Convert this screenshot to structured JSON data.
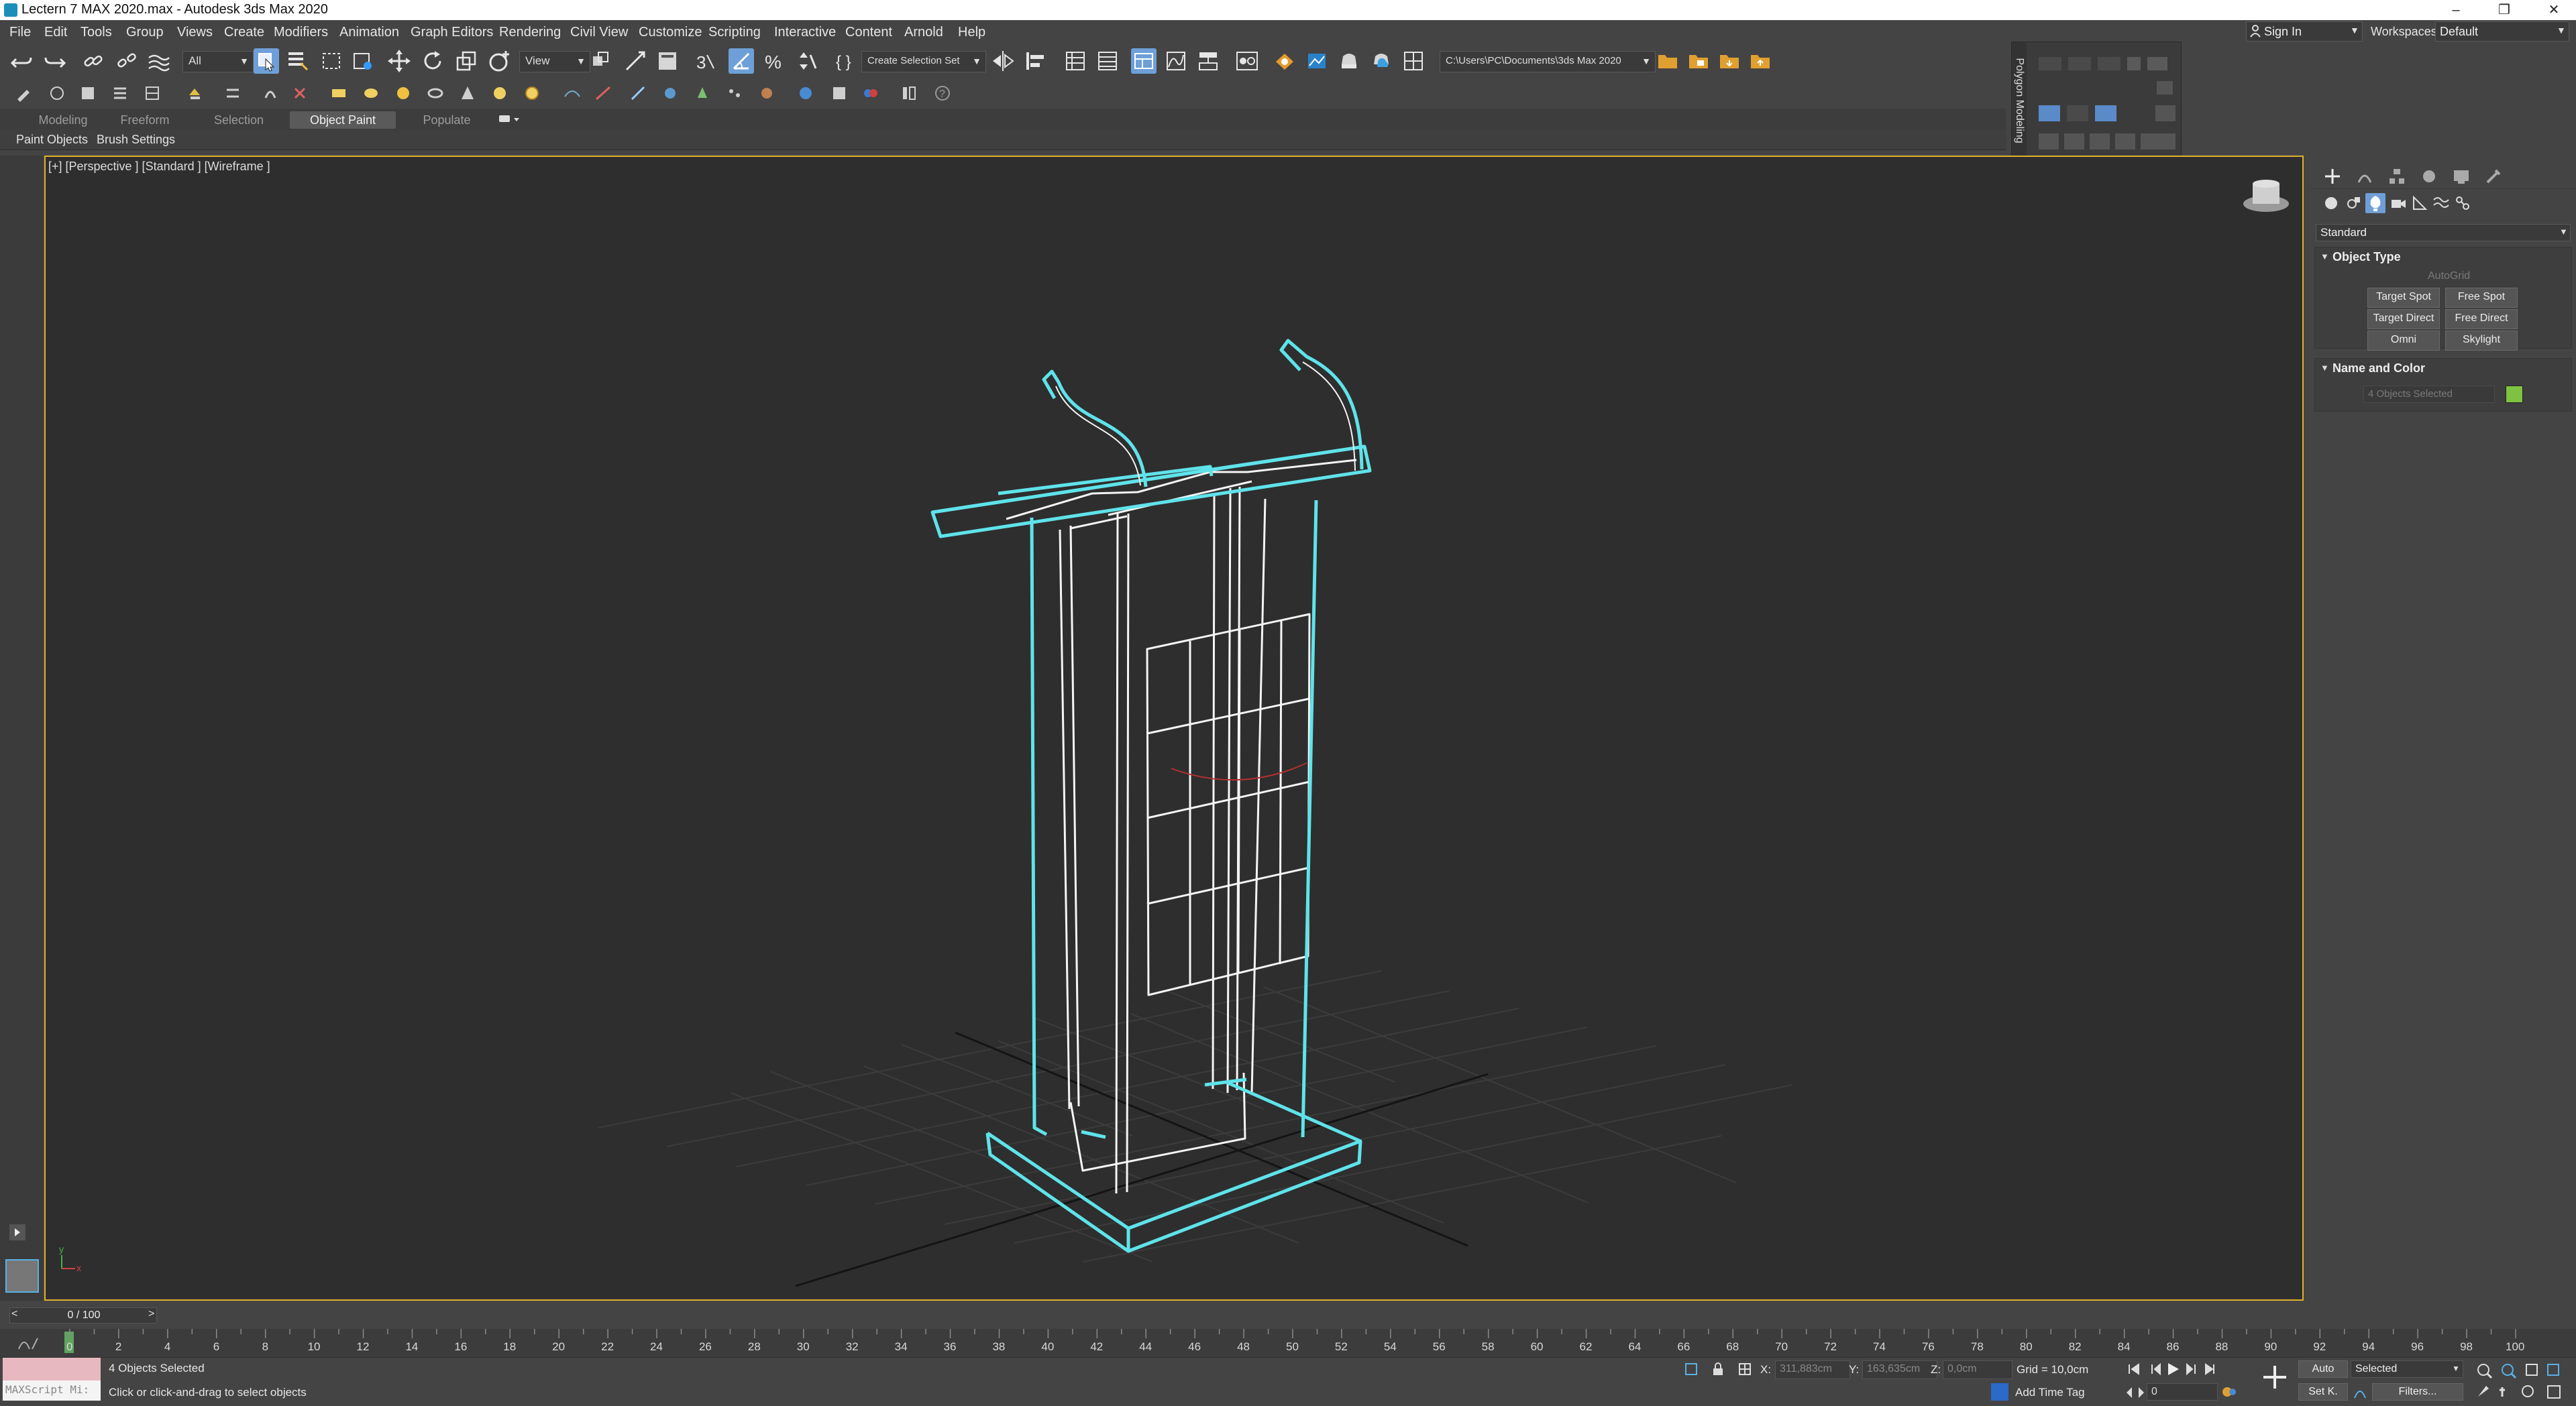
{
  "window": {
    "title": "Lectern 7 MAX 2020.max - Autodesk 3ds Max 2020",
    "minimize": "–",
    "restore": "❐",
    "close": "✕"
  },
  "menu": [
    "File",
    "Edit",
    "Tools",
    "Group",
    "Views",
    "Create",
    "Modifiers",
    "Animation",
    "Graph Editors",
    "Rendering",
    "Civil View",
    "Customize",
    "Scripting",
    "Interactive",
    "Content",
    "Arnold",
    "Help"
  ],
  "account": {
    "sign_in": "Sign In",
    "workspaces_label": "Workspaces:",
    "workspace_value": "Default"
  },
  "toolbar": {
    "selection_filter": "All",
    "ref_coord": "View",
    "named_selection": "Create Selection Set",
    "project_path": "C:\\Users\\PC\\Documents\\3ds Max 2020"
  },
  "ribbon": {
    "tabs": [
      "Modeling",
      "Freeform",
      "Selection",
      "Object Paint",
      "Populate"
    ],
    "active_tab": "Object Paint",
    "sub_items": [
      "Paint Objects",
      "Brush Settings"
    ]
  },
  "poly_float": {
    "label": "Polygon Modeling"
  },
  "viewport": {
    "label": "[+] [Perspective ] [Standard ] [Wireframe ]",
    "wire_color": "#5fe3ea",
    "axis_x": "x",
    "axis_y": "y"
  },
  "command_panel": {
    "category": "Standard",
    "object_type": {
      "header": "Object Type",
      "autogrid": "AutoGrid",
      "buttons": [
        "Target Spot",
        "Free Spot",
        "Target Direct",
        "Free Direct",
        "Omni",
        "Skylight"
      ]
    },
    "name_color": {
      "header": "Name and Color",
      "name_value": "4 Objects Selected",
      "swatch": "#7fc241"
    }
  },
  "timeline": {
    "frame_display": "0 / 100",
    "ticks": [
      "0",
      "2",
      "4",
      "6",
      "8",
      "10",
      "12",
      "14",
      "16",
      "18",
      "20",
      "22",
      "24",
      "26",
      "28",
      "30",
      "32",
      "34",
      "36",
      "38",
      "40",
      "42",
      "44",
      "46",
      "48",
      "50",
      "52",
      "54",
      "56",
      "58",
      "60",
      "62",
      "64",
      "66",
      "68",
      "70",
      "72",
      "74",
      "76",
      "78",
      "80",
      "82",
      "84",
      "86",
      "88",
      "90",
      "92",
      "94",
      "96",
      "98",
      "100"
    ]
  },
  "status": {
    "maxscript": "MAXScript Mi:",
    "selection": "4 Objects Selected",
    "prompt": "Click or click-and-drag to select objects",
    "x_label": "X:",
    "x_value": "311,883cm",
    "y_label": "Y:",
    "y_value": "163,635cm",
    "z_label": "Z:",
    "z_value": "0,0cm",
    "grid": "Grid = 10,0cm",
    "add_time_tag": "Add Time Tag",
    "auto_key": "Auto",
    "set_key": "Set K.",
    "key_filter_value": "Selected",
    "filters": "Filters...",
    "current_frame": "0"
  }
}
